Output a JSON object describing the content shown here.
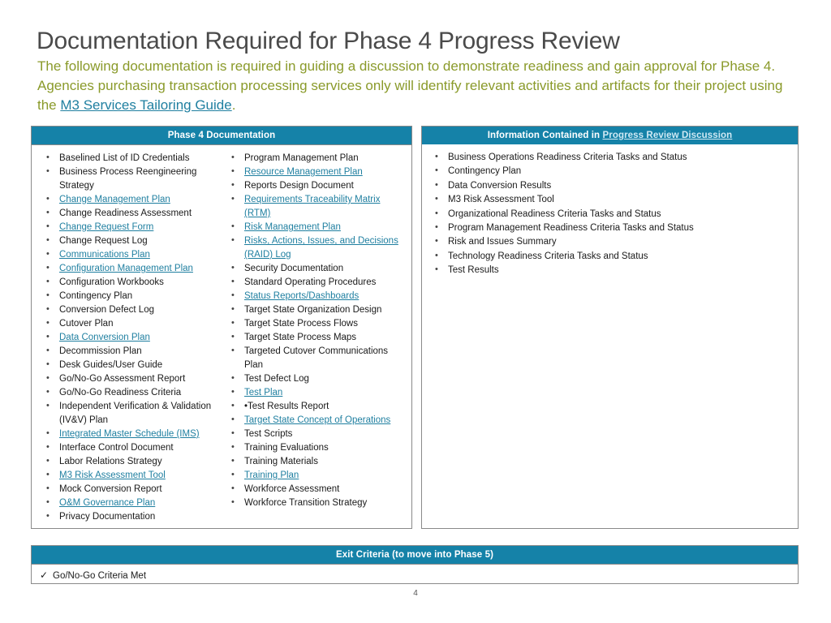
{
  "title": "Documentation Required for Phase 4 Progress Review",
  "subtitle": {
    "part1": "The following documentation is required in guiding a discussion to demonstrate readiness and gain approval for Phase 4. Agencies purchasing transaction processing services only will identify relevant activities and artifacts for their project using the ",
    "link": "M3 Services Tailoring Guide",
    "part2": "."
  },
  "phase4": {
    "header": "Phase 4 Documentation",
    "column1": [
      {
        "text": "Baselined List of ID Credentials",
        "link": false
      },
      {
        "text": "Business Process Reengineering Strategy",
        "link": false
      },
      {
        "text": "Change Management Plan ",
        "link": true
      },
      {
        "text": "Change Readiness Assessment",
        "link": false
      },
      {
        "text": "Change Request Form",
        "link": true
      },
      {
        "text": "Change Request Log",
        "link": false
      },
      {
        "text": "Communications Plan",
        "link": true
      },
      {
        "text": "Configuration Management Plan",
        "link": true
      },
      {
        "text": "Configuration Workbooks",
        "link": false
      },
      {
        "text": "Contingency Plan",
        "link": false
      },
      {
        "text": "Conversion Defect Log",
        "link": false
      },
      {
        "text": "Cutover Plan",
        "link": false
      },
      {
        "text": "Data Conversion Plan ",
        "link": true
      },
      {
        "text": "Decommission Plan",
        "link": false
      },
      {
        "text": "Desk Guides/User Guide",
        "link": false
      },
      {
        "text": "Go/No-Go Assessment Report",
        "link": false
      },
      {
        "text": "Go/No-Go Readiness Criteria",
        "link": false
      },
      {
        "text": "Independent Verification & Validation (IV&V) Plan",
        "link": false
      },
      {
        "text": "Integrated Master Schedule (IMS)",
        "link": true
      },
      {
        "text": "Interface Control Document",
        "link": false
      },
      {
        "text": "Labor Relations Strategy",
        "link": false
      },
      {
        "text": "M3 Risk Assessment Tool",
        "link": true
      },
      {
        "text": "Mock Conversion Report",
        "link": false
      },
      {
        "text": "O&M Governance Plan ",
        "link": true
      },
      {
        "text": "Privacy Documentation",
        "link": false
      }
    ],
    "column2": [
      {
        "text": "Program Management Plan",
        "link": false
      },
      {
        "text": "Resource Management Plan",
        "link": true
      },
      {
        "text": "Reports Design Document",
        "link": false
      },
      {
        "text": "Requirements Traceability Matrix (RTM)",
        "link": true
      },
      {
        "text": "Risk Management Plan",
        "link": true
      },
      {
        "text": "Risks, Actions, Issues, and Decisions (RAID) Log ",
        "link": true
      },
      {
        "text": "Security Documentation",
        "link": false
      },
      {
        "text": "Standard Operating Procedures",
        "link": false
      },
      {
        "text": "Status Reports/Dashboards",
        "link": true
      },
      {
        "text": "Target State Organization Design",
        "link": false
      },
      {
        "text": "Target State Process Flows",
        "link": false
      },
      {
        "text": "Target State Process Maps",
        "link": false
      },
      {
        "text": "Targeted Cutover Communications Plan",
        "link": false
      },
      {
        "text": "Test Defect Log",
        "link": false
      },
      {
        "text": "Test Plan",
        "link": true
      },
      {
        "text": "•Test Results Report",
        "link": false
      },
      {
        "text": "Target State Concept of Operations",
        "link": true
      },
      {
        "text": "Test Scripts",
        "link": false
      },
      {
        "text": "Training Evaluations",
        "link": false
      },
      {
        "text": "Training Materials",
        "link": false
      },
      {
        "text": "Training Plan ",
        "link": true
      },
      {
        "text": "Workforce Assessment",
        "link": false
      },
      {
        "text": "Workforce Transition Strategy",
        "link": false
      }
    ]
  },
  "info": {
    "header_prefix": "Information Contained in ",
    "header_link": "Progress Review Discussion",
    "items": [
      "Business Operations Readiness Criteria Tasks and Status",
      "Contingency Plan",
      "Data Conversion Results",
      "M3 Risk Assessment Tool",
      "Organizational Readiness Criteria Tasks and Status",
      "Program Management Readiness Criteria Tasks and Status",
      "Risk and Issues Summary",
      "Technology Readiness Criteria Tasks and Status",
      "Test Results"
    ]
  },
  "exit": {
    "header": "Exit Criteria (to move into Phase 5)",
    "check": "✓",
    "item": "Go/No-Go Criteria Met"
  },
  "page_number": "4"
}
